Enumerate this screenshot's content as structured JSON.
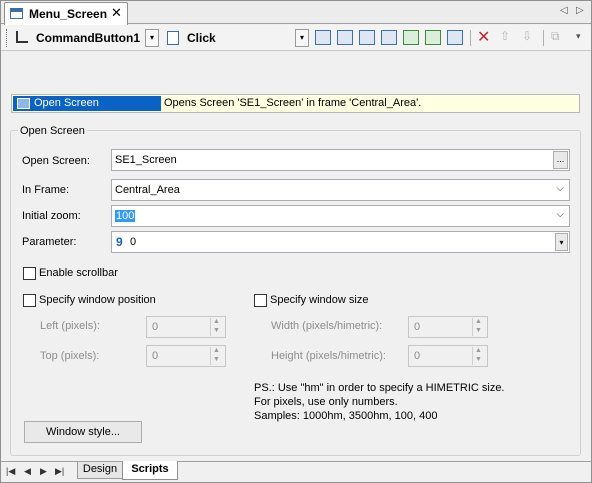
{
  "document_tab": {
    "title": "Menu_Screen",
    "close": "✕",
    "prev": "◁",
    "next": "▷"
  },
  "toolbar": {
    "object": "CommandButton1",
    "event": "Click",
    "dropdown_glyph": "▾",
    "icons": [
      "add-action-icon",
      "insert-action-icon",
      "edit-action-icon",
      "script-action-icon",
      "link-action-icon",
      "refresh-action-icon",
      "print-action-icon",
      "delete-icon",
      "move-up-icon",
      "move-down-icon",
      "copy-icon"
    ]
  },
  "action": {
    "name": "Open Screen",
    "description": "Opens Screen 'SE1_Screen' in frame 'Central_Area'."
  },
  "group": {
    "title": "Open Screen"
  },
  "fields": {
    "open_screen": {
      "label": "Open Screen:",
      "value": "SE1_Screen",
      "browse": "..."
    },
    "in_frame": {
      "label": "In Frame:",
      "value": "Central_Area"
    },
    "initial_zoom": {
      "label": "Initial zoom:",
      "value": "100"
    },
    "parameter": {
      "label": "Parameter:",
      "type_glyph": "9",
      "value": "0"
    }
  },
  "enable_scrollbar": {
    "label": "Enable scrollbar",
    "checked": false
  },
  "window_position": {
    "label": "Specify window position",
    "checked": false,
    "left": {
      "label": "Left (pixels):",
      "value": "0"
    },
    "top": {
      "label": "Top (pixels):",
      "value": "0"
    }
  },
  "window_size": {
    "label": "Specify window size",
    "checked": false,
    "width": {
      "label": "Width (pixels/himetric):",
      "value": "0"
    },
    "height": {
      "label": "Height (pixels/himetric):",
      "value": "0"
    }
  },
  "note": {
    "line1": "PS.: Use \"hm\" in order to specify a HIMETRIC size.",
    "line2": "For pixels, use only numbers.",
    "line3": "Samples: 1000hm, 3500hm, 100, 400"
  },
  "window_style_button": "Window style...",
  "bottom_tabs": {
    "design": "Design",
    "scripts": "Scripts"
  },
  "bottom_nav": {
    "first": "|◀",
    "prev": "◀",
    "next": "▶",
    "last": "▶|"
  },
  "spin_glyphs": {
    "up": "▲",
    "down": "▼"
  },
  "chevron": "⌵"
}
